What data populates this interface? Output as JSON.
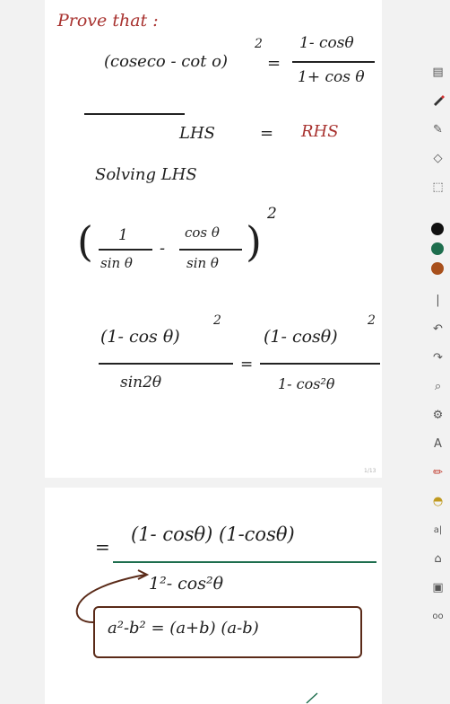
{
  "notes": {
    "page1": {
      "title": "Prove that :",
      "equation": {
        "lhs": "(coseco - cot o)",
        "lhs_exp": "2",
        "equals": "=",
        "rhs_num": "1- cosθ",
        "rhs_den": "1+ cos θ"
      },
      "lhs_label": "LHS",
      "eq_sign": "=",
      "rhs_label": "RHS",
      "solving_label": "Solving LHS",
      "step1": {
        "frac1_num": "1",
        "frac1_den": "sin θ",
        "minus": "-",
        "frac2_num": "cos θ",
        "frac2_den": "sin θ",
        "exp": "2"
      },
      "step2": {
        "left_num": "(1- cos θ)",
        "left_exp": "2",
        "left_den": "sin2θ",
        "equals": "=",
        "right_num": "(1- cosθ)",
        "right_exp": "2",
        "right_den": "1- cos²θ"
      },
      "page_number": "1/13"
    },
    "page2": {
      "equals": "=",
      "numerator": "(1- cosθ) (1-cosθ)",
      "denominator": "1²- cos²θ",
      "identity": "a²-b² = (a+b) (a-b)"
    }
  },
  "toolbar": {
    "tools": [
      "pages-icon",
      "pen-icon",
      "highlighter-icon",
      "eraser-icon",
      "lasso-icon"
    ],
    "colors": [
      "#111111",
      "#1e6e4e",
      "#a8501c"
    ],
    "colors_label": "pen colors",
    "actions": [
      "undo-icon",
      "redo-icon",
      "zoom-icon",
      "settings-icon",
      "text-icon",
      "red-pen-icon",
      "stamp-icon",
      "ocr-icon",
      "tag-icon",
      "lock-icon",
      "more-icon"
    ]
  }
}
